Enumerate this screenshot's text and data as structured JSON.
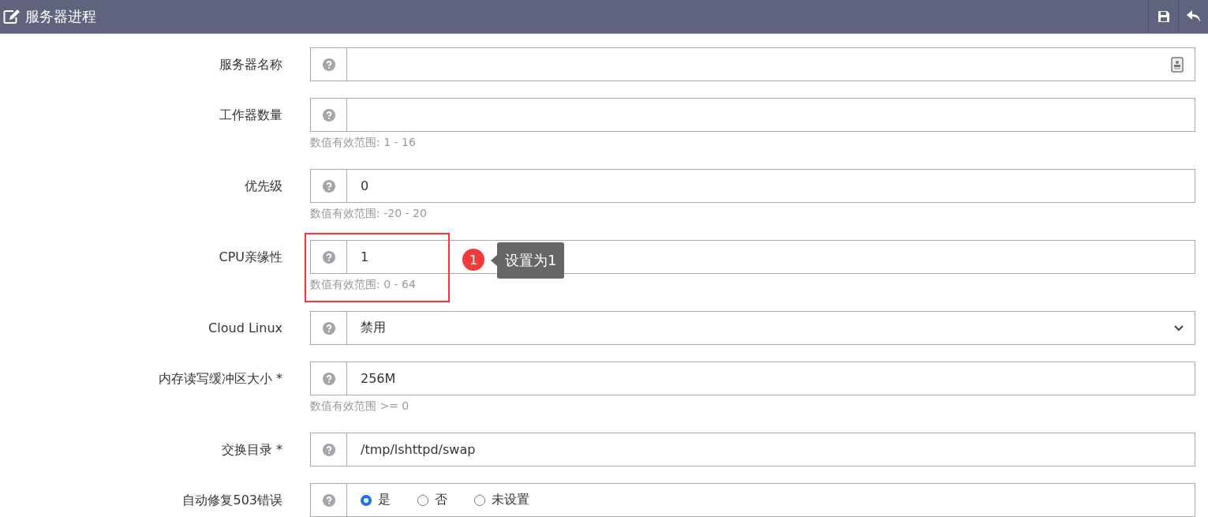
{
  "header": {
    "title": "服务器进程"
  },
  "fields": [
    {
      "kind": "picker",
      "label": "服务器名称"
    },
    {
      "kind": "text",
      "label": "工作器数量",
      "hint": "数值有效范围: 1 - 16"
    },
    {
      "kind": "text",
      "label": "优先级",
      "value": "0",
      "hint": "数值有效范围: -20 - 20"
    },
    {
      "kind": "text",
      "label": "CPU亲缘性",
      "value": "1",
      "hint": "数值有效范围: 0 - 64",
      "annotation": {
        "number": "1",
        "text": "设置为1"
      }
    },
    {
      "kind": "select",
      "label": "Cloud Linux",
      "value": "禁用"
    },
    {
      "kind": "text",
      "label": "内存读写缓冲区大小 *",
      "value": "256M",
      "hint": "数值有效范围 >= 0"
    },
    {
      "kind": "text",
      "label": "交换目录 *",
      "value": "/tmp/lshttpd/swap"
    },
    {
      "kind": "radio",
      "label": "自动修复503错误",
      "options": [
        {
          "label": "是",
          "selected": true
        },
        {
          "label": "否",
          "selected": false
        },
        {
          "label": "未设置",
          "selected": false
        }
      ]
    }
  ]
}
